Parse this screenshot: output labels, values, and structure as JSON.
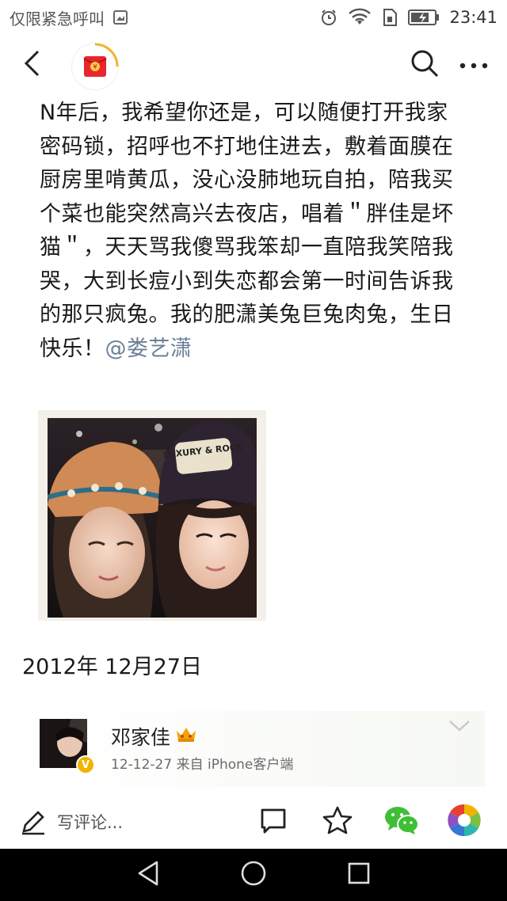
{
  "status_bar": {
    "carrier": "仅限紧急呼叫",
    "time": "23:41"
  },
  "post": {
    "text": "N年后，我希望你还是，可以随便打开我家密码锁，招呼也不打地住进去，敷着面膜在厨房里啃黄瓜，没心没肺地玩自拍，陪我买个菜也能突然高兴去夜店，唱着＂胖佳是坏猫＂，天天骂我傻骂我笨却一直陪我笑陪我哭，大到长痘小到失恋都会第一时间告诉我的那只疯兔。我的肥潇美兔巨兔肉兔，生日快乐！",
    "mention": "@娄艺潇",
    "photo": {
      "cap_text": "LUXURY & ROCK"
    },
    "date": "2012年 12月27日"
  },
  "comment": {
    "name": "邓家佳",
    "meta": "12-12-27  来自 iPhone客户端",
    "verified_mark": "V"
  },
  "bottom_bar": {
    "write_placeholder": "写评论..."
  },
  "icons": {
    "back": "back-arrow-icon",
    "search": "search-icon",
    "more": "more-icon",
    "edit": "pencil-icon",
    "comment": "comment-icon",
    "like": "star-icon",
    "wechat": "wechat-icon",
    "moments": "moments-icon"
  },
  "colors": {
    "mention": "#6b7f97",
    "wechat": "#3fbf36",
    "avatar_red": "#e8262b",
    "avatar_ring": "#f2b430"
  }
}
